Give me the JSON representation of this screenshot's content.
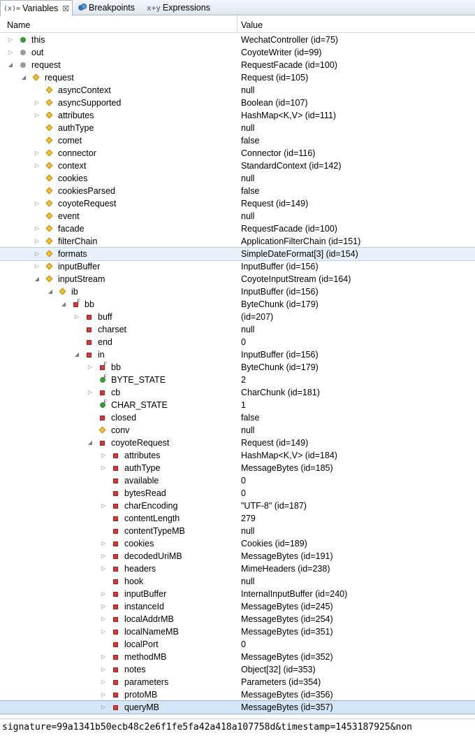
{
  "tabs": [
    {
      "label": "Variables",
      "icon": "(x)=",
      "close": "☒"
    },
    {
      "label": "Breakpoints",
      "icon": "breakpoints-icon"
    },
    {
      "label": "Expressions",
      "icon": "expressions-icon"
    }
  ],
  "columns": {
    "name": "Name",
    "value": "Value"
  },
  "rows": [
    {
      "d": 0,
      "t": "c",
      "i": "green-dot",
      "n": "this",
      "v": "WechatController  (id=75)"
    },
    {
      "d": 0,
      "t": "c",
      "i": "gray-dot",
      "n": "out",
      "v": "CoyoteWriter  (id=99)"
    },
    {
      "d": 0,
      "t": "e",
      "i": "gray-dot",
      "n": "request",
      "v": "RequestFacade  (id=100)"
    },
    {
      "d": 1,
      "t": "e",
      "i": "diamond",
      "n": "request",
      "v": "Request  (id=105)"
    },
    {
      "d": 2,
      "t": "n",
      "i": "diamond",
      "n": "asyncContext",
      "v": "null"
    },
    {
      "d": 2,
      "t": "c",
      "i": "diamond",
      "n": "asyncSupported",
      "v": "Boolean  (id=107)"
    },
    {
      "d": 2,
      "t": "c",
      "i": "diamond",
      "n": "attributes",
      "v": "HashMap<K,V>  (id=111)"
    },
    {
      "d": 2,
      "t": "n",
      "i": "diamond",
      "n": "authType",
      "v": "null"
    },
    {
      "d": 2,
      "t": "n",
      "i": "diamond",
      "n": "comet",
      "v": "false"
    },
    {
      "d": 2,
      "t": "c",
      "i": "diamond",
      "n": "connector",
      "v": "Connector  (id=116)"
    },
    {
      "d": 2,
      "t": "c",
      "i": "diamond",
      "n": "context",
      "v": "StandardContext  (id=142)"
    },
    {
      "d": 2,
      "t": "n",
      "i": "diamond",
      "n": "cookies",
      "v": "null"
    },
    {
      "d": 2,
      "t": "n",
      "i": "diamond",
      "n": "cookiesParsed",
      "v": "false"
    },
    {
      "d": 2,
      "t": "c",
      "i": "diamond",
      "n": "coyoteRequest",
      "v": "Request  (id=149)"
    },
    {
      "d": 2,
      "t": "n",
      "i": "diamond",
      "n": "event",
      "v": "null"
    },
    {
      "d": 2,
      "t": "c",
      "i": "diamond",
      "n": "facade",
      "v": "RequestFacade  (id=100)"
    },
    {
      "d": 2,
      "t": "c",
      "i": "diamond",
      "n": "filterChain",
      "v": "ApplicationFilterChain  (id=151)"
    },
    {
      "d": 2,
      "t": "c",
      "i": "diamond",
      "n": "formats",
      "v": "SimpleDateFormat[3]  (id=154)",
      "sel": 1
    },
    {
      "d": 2,
      "t": "c",
      "i": "diamond",
      "n": "inputBuffer",
      "v": "InputBuffer  (id=156)"
    },
    {
      "d": 2,
      "t": "e",
      "i": "diamond",
      "n": "inputStream",
      "v": "CoyoteInputStream  (id=164)"
    },
    {
      "d": 3,
      "t": "e",
      "i": "diamond",
      "n": "ib",
      "v": "InputBuffer  (id=156)"
    },
    {
      "d": 4,
      "t": "e",
      "i": "square",
      "f": 1,
      "n": "bb",
      "v": "ByteChunk  (id=179)"
    },
    {
      "d": 5,
      "t": "c",
      "i": "square",
      "n": "buff",
      "v": "(id=207)"
    },
    {
      "d": 5,
      "t": "n",
      "i": "square",
      "n": "charset",
      "v": "null"
    },
    {
      "d": 5,
      "t": "n",
      "i": "square",
      "n": "end",
      "v": "0"
    },
    {
      "d": 5,
      "t": "e",
      "i": "square",
      "n": "in",
      "v": "InputBuffer  (id=156)"
    },
    {
      "d": 6,
      "t": "c",
      "i": "square",
      "f": 1,
      "n": "bb",
      "v": "ByteChunk  (id=179)"
    },
    {
      "d": 6,
      "t": "n",
      "i": "green-dot",
      "f": 1,
      "n": "BYTE_STATE",
      "v": "2"
    },
    {
      "d": 6,
      "t": "c",
      "i": "square",
      "n": "cb",
      "v": "CharChunk  (id=181)"
    },
    {
      "d": 6,
      "t": "n",
      "i": "green-dot",
      "f": 1,
      "n": "CHAR_STATE",
      "v": "1"
    },
    {
      "d": 6,
      "t": "n",
      "i": "square",
      "n": "closed",
      "v": "false"
    },
    {
      "d": 6,
      "t": "n",
      "i": "diamond",
      "n": "conv",
      "v": "null"
    },
    {
      "d": 6,
      "t": "e",
      "i": "square",
      "n": "coyoteRequest",
      "v": "Request  (id=149)"
    },
    {
      "d": 7,
      "t": "c",
      "i": "square",
      "n": "attributes",
      "v": "HashMap<K,V>  (id=184)"
    },
    {
      "d": 7,
      "t": "c",
      "i": "square",
      "n": "authType",
      "v": "MessageBytes  (id=185)"
    },
    {
      "d": 7,
      "t": "n",
      "i": "square",
      "n": "available",
      "v": "0"
    },
    {
      "d": 7,
      "t": "n",
      "i": "square",
      "n": "bytesRead",
      "v": "0"
    },
    {
      "d": 7,
      "t": "c",
      "i": "square",
      "n": "charEncoding",
      "v": "\"UTF-8\" (id=187)"
    },
    {
      "d": 7,
      "t": "n",
      "i": "square",
      "n": "contentLength",
      "v": "279"
    },
    {
      "d": 7,
      "t": "n",
      "i": "square",
      "n": "contentTypeMB",
      "v": "null"
    },
    {
      "d": 7,
      "t": "c",
      "i": "square",
      "n": "cookies",
      "v": "Cookies  (id=189)"
    },
    {
      "d": 7,
      "t": "c",
      "i": "square",
      "n": "decodedUriMB",
      "v": "MessageBytes  (id=191)"
    },
    {
      "d": 7,
      "t": "c",
      "i": "square",
      "n": "headers",
      "v": "MimeHeaders  (id=238)"
    },
    {
      "d": 7,
      "t": "n",
      "i": "square",
      "n": "hook",
      "v": "null"
    },
    {
      "d": 7,
      "t": "c",
      "i": "square",
      "n": "inputBuffer",
      "v": "InternalInputBuffer  (id=240)"
    },
    {
      "d": 7,
      "t": "c",
      "i": "square",
      "n": "instanceId",
      "v": "MessageBytes  (id=245)"
    },
    {
      "d": 7,
      "t": "c",
      "i": "square",
      "n": "localAddrMB",
      "v": "MessageBytes  (id=254)"
    },
    {
      "d": 7,
      "t": "c",
      "i": "square",
      "n": "localNameMB",
      "v": "MessageBytes  (id=351)"
    },
    {
      "d": 7,
      "t": "n",
      "i": "square",
      "n": "localPort",
      "v": "0"
    },
    {
      "d": 7,
      "t": "c",
      "i": "square",
      "n": "methodMB",
      "v": "MessageBytes  (id=352)"
    },
    {
      "d": 7,
      "t": "c",
      "i": "square",
      "n": "notes",
      "v": "Object[32]  (id=353)"
    },
    {
      "d": 7,
      "t": "c",
      "i": "square",
      "n": "parameters",
      "v": "Parameters  (id=354)"
    },
    {
      "d": 7,
      "t": "c",
      "i": "square",
      "n": "protoMB",
      "v": "MessageBytes  (id=356)"
    },
    {
      "d": 7,
      "t": "c",
      "i": "square",
      "n": "queryMB",
      "v": "MessageBytes  (id=357)",
      "sel": 2
    }
  ],
  "detail_text": "signature=99a1341b50ecb48c2e6f1fe5fa42a418a107758d&timestamp=1453187925&non"
}
